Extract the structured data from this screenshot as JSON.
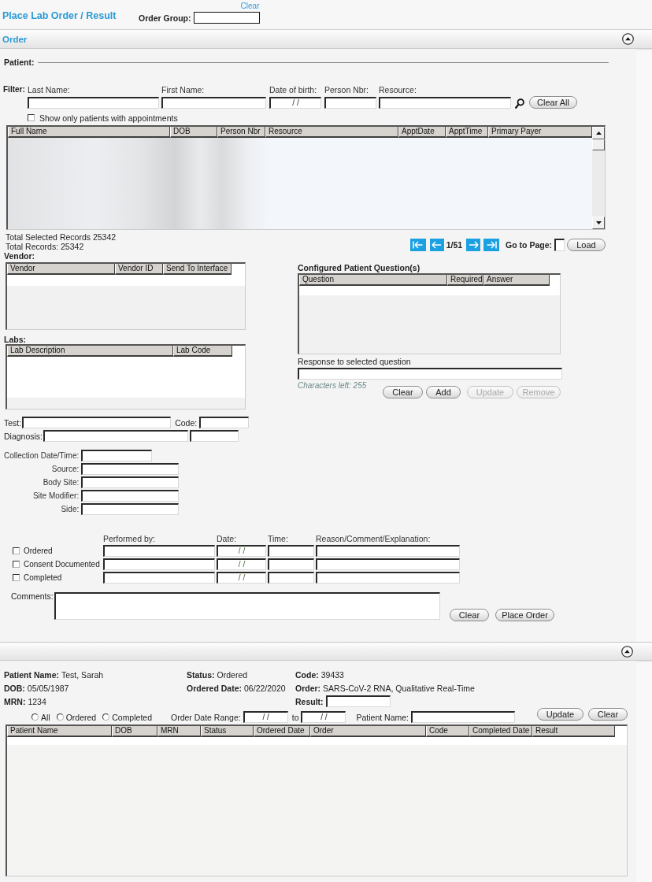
{
  "header": {
    "title": "Place Lab Order / Result",
    "clear_link": "Clear",
    "order_group_label": "Order Group:"
  },
  "order_section": {
    "title": "Order"
  },
  "patient": {
    "label": "Patient:",
    "filter_label": "Filter:",
    "filter_fields": [
      {
        "label": "Last Name:"
      },
      {
        "label": "First Name:"
      },
      {
        "label": "Date of birth:",
        "value": "/ /"
      },
      {
        "label": "Person Nbr:"
      },
      {
        "label": "Resource:"
      }
    ],
    "clear_all_button": "Clear All",
    "appointments_only": {
      "label": "Show only patients with appointments",
      "checked": false
    },
    "grid_columns": [
      "Full Name",
      "DOB",
      "Person Nbr",
      "Resource",
      "ApptDate",
      "ApptTime",
      "Primary Payer"
    ],
    "total_selected": "Total Selected Records 25342",
    "total_records": "Total Records: 25342",
    "page": "1/51",
    "go_to_page_label": "Go to Page:",
    "load_button": "Load"
  },
  "vendor": {
    "label": "Vendor:",
    "columns": [
      "Vendor",
      "Vendor ID",
      "Send To Interface"
    ]
  },
  "labs": {
    "label": "Labs:",
    "columns": [
      "Lab Description",
      "Lab Code"
    ]
  },
  "test": {
    "label": "Test:",
    "code_label": "Code:"
  },
  "diagnosis": {
    "label": "Diagnosis:"
  },
  "collection_fields": [
    {
      "label": "Collection Date/Time:"
    },
    {
      "label": "Source:"
    },
    {
      "label": "Body Site:"
    },
    {
      "label": "Site Modifier:"
    },
    {
      "label": "Side:"
    }
  ],
  "questions": {
    "title": "Configured Patient Question(s)",
    "columns": [
      "Question",
      "Required",
      "Answer"
    ],
    "response_label": "Response to selected question",
    "characters_left": "Characters left: 255",
    "buttons": [
      {
        "label": "Clear",
        "disabled": false
      },
      {
        "label": "Add",
        "disabled": false
      },
      {
        "label": "Update",
        "disabled": true
      },
      {
        "label": "Remove",
        "disabled": true
      }
    ]
  },
  "status_table": {
    "columns": [
      "Performed by:",
      "Date:",
      "Time:",
      "Reason/Comment/Explanation:"
    ],
    "rows": [
      {
        "label": "Ordered",
        "checked": false,
        "date": "/ /"
      },
      {
        "label": "Consent Documented",
        "checked": false,
        "date": "/ /"
      },
      {
        "label": "Completed",
        "checked": false,
        "date": "/ /"
      }
    ]
  },
  "comments": {
    "label": "Comments:"
  },
  "order_buttons": [
    "Clear",
    "Place Order"
  ],
  "results": {
    "details": [
      [
        {
          "kind": "text",
          "label": "Patient Name:",
          "value": "Test, Sarah"
        },
        {
          "kind": "text",
          "label": "DOB:",
          "value": "05/05/1987"
        },
        {
          "kind": "text",
          "label": "MRN:",
          "value": "1234"
        }
      ],
      [
        {
          "kind": "text",
          "label": "Status:",
          "value": "Ordered"
        },
        {
          "kind": "text",
          "label": "Ordered Date:",
          "value": "06/22/2020"
        }
      ],
      [
        {
          "kind": "text",
          "label": "Code:",
          "value": "39433"
        },
        {
          "kind": "text",
          "label": "Order:",
          "value": "SARS-CoV-2 RNA, Qualitative Real-Time"
        },
        {
          "kind": "field",
          "label": "Result:"
        }
      ]
    ],
    "status_filter": [
      {
        "label": "All",
        "selected": false
      },
      {
        "label": "Ordered",
        "selected": false
      },
      {
        "label": "Completed",
        "selected": false
      }
    ],
    "date_range": {
      "label": "Order Date Range:",
      "from": "/ /",
      "to_label": "to",
      "to": "/ /"
    },
    "patient_name_label": "Patient Name:",
    "buttons": [
      "Update",
      "Clear"
    ],
    "columns": [
      "Patient Name",
      "DOB",
      "MRN",
      "Status",
      "Ordered Date",
      "Order",
      "Code",
      "Completed Date",
      "Result"
    ]
  }
}
